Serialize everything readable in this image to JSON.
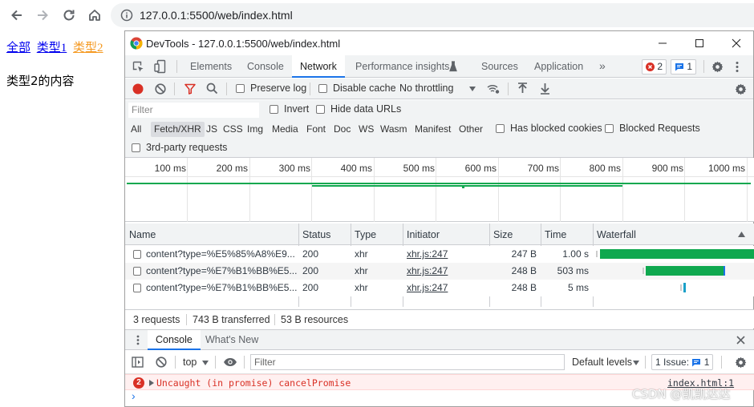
{
  "browser": {
    "url": "127.0.0.1:5500/web/index.html"
  },
  "page": {
    "links": [
      "全部",
      "类型1",
      "类型2"
    ],
    "content": "类型2的内容"
  },
  "devtools": {
    "title": "DevTools - 127.0.0.1:5500/web/index.html",
    "tabs": [
      "Elements",
      "Console",
      "Network",
      "Performance insights",
      "Sources",
      "Application"
    ],
    "more_tabs": "»",
    "error_count": "2",
    "message_count": "1",
    "toolbar": {
      "preserve_log": "Preserve log",
      "disable_cache": "Disable cache",
      "throttling": "No throttling"
    },
    "filter": {
      "placeholder": "Filter",
      "invert": "Invert",
      "hide_data_urls": "Hide data URLs",
      "types": [
        "All",
        "Fetch/XHR",
        "JS",
        "CSS",
        "Img",
        "Media",
        "Font",
        "Doc",
        "WS",
        "Wasm",
        "Manifest",
        "Other"
      ],
      "has_blocked_cookies": "Has blocked cookies",
      "blocked_requests": "Blocked Requests",
      "third_party": "3rd-party requests"
    },
    "overview_ticks": [
      "100 ms",
      "200 ms",
      "300 ms",
      "400 ms",
      "500 ms",
      "600 ms",
      "700 ms",
      "800 ms",
      "900 ms",
      "1000 ms"
    ],
    "table": {
      "columns": [
        "Name",
        "Status",
        "Type",
        "Initiator",
        "Size",
        "Time",
        "Waterfall"
      ],
      "rows": [
        {
          "name": "content?type=%E5%85%A8%E9...",
          "status": "200",
          "type": "xhr",
          "initiator": "xhr.js:247",
          "size": "247 B",
          "time": "1.00 s"
        },
        {
          "name": "content?type=%E7%B1%BB%E5...",
          "status": "200",
          "type": "xhr",
          "initiator": "xhr.js:247",
          "size": "248 B",
          "time": "503 ms"
        },
        {
          "name": "content?type=%E7%B1%BB%E5...",
          "status": "200",
          "type": "xhr",
          "initiator": "xhr.js:247",
          "size": "248 B",
          "time": "5 ms"
        }
      ]
    },
    "summary": {
      "requests": "3 requests",
      "transferred": "743 B transferred",
      "resources": "53 B resources"
    },
    "drawer": {
      "tabs": [
        "Console",
        "What's New"
      ],
      "context": "top",
      "filter_placeholder": "Filter",
      "levels": "Default levels",
      "issues_label": "1 Issue:",
      "issues_count": "1"
    },
    "console_error": {
      "count": "2",
      "message": "Uncaught (in promise) cancelPromise",
      "source": "index.html:1"
    },
    "prompt": "›"
  },
  "watermark": "CSDN @凯凯达达",
  "colors": {
    "accent": "#1a73e8",
    "error": "#d93025",
    "waterfall_green": "#0fa84f",
    "waterfall_blue": "#1a73e8"
  }
}
